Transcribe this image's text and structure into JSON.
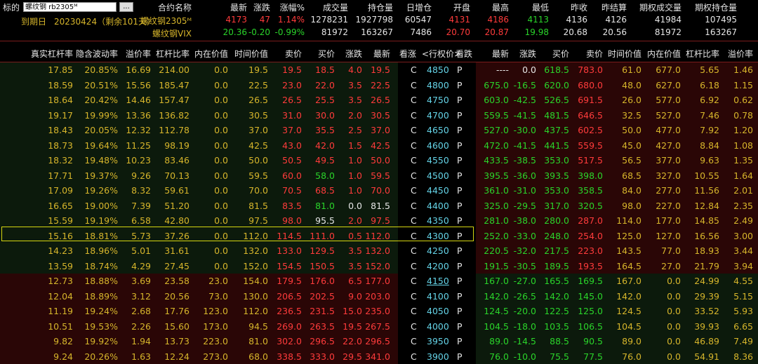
{
  "header": {
    "label_symbol": "标的",
    "symbol_input": "螺纹钢 rb2305ᴹ",
    "dots": "...",
    "expiry_label": "到期日",
    "expiry_value": "20230424（剩余101天）",
    "columns": [
      "合约名称",
      "最新",
      "涨跌",
      "涨幅%",
      "成交量",
      "持仓量",
      "日增仓",
      "开盘",
      "最高",
      "最低",
      "昨收",
      "昨结算",
      "期权成交量",
      "期权持仓量"
    ],
    "rows": [
      {
        "name": "螺纹钢2305ᴹ",
        "latest": "4173",
        "change": "47",
        "pct": "1.14%",
        "volume": "1278231",
        "oi": "1927798",
        "daily_oi": "60547",
        "open": "4131",
        "high": "4186",
        "low": "4113",
        "prev_close": "4136",
        "prev_settle": "4126",
        "opt_vol": "41984",
        "opt_oi": "107495"
      },
      {
        "name": "螺纹钢VIX",
        "latest": "20.36",
        "change": "-0.20",
        "pct": "-0.99%",
        "volume": "81972",
        "oi": "163267",
        "daily_oi": "7486",
        "open": "20.70",
        "high": "20.87",
        "low": "19.98",
        "prev_close": "20.68",
        "prev_settle": "20.56",
        "opt_vol": "81972",
        "opt_oi": "163267"
      }
    ]
  },
  "table": {
    "call_headers": [
      "真实杠杆率",
      "隐含波动率",
      "溢价率",
      "杠杆比率",
      "内在价值",
      "时间价值",
      "卖价",
      "买价",
      "涨跌",
      "最新"
    ],
    "mid_headers": [
      "看涨",
      "<行权价>",
      "看跌"
    ],
    "put_headers": [
      "最新",
      "涨跌",
      "买价",
      "卖价",
      "时间价值",
      "内在价值",
      "杠杆比率",
      "溢价率"
    ],
    "rows": [
      {
        "c": [
          "17.85",
          "20.85%",
          "16.69",
          "214.00",
          "0.0",
          "19.5",
          "19.5",
          "18.5",
          "4.0",
          "19.5"
        ],
        "strike": "4850",
        "p": [
          "----",
          "0.0",
          "618.5",
          "783.0",
          "61.0",
          "677.0",
          "5.65",
          "1.46"
        ]
      },
      {
        "c": [
          "18.59",
          "20.51%",
          "15.56",
          "185.47",
          "0.0",
          "22.5",
          "23.0",
          "22.0",
          "3.5",
          "22.5"
        ],
        "strike": "4800",
        "p": [
          "675.0",
          "-16.5",
          "620.0",
          "680.0",
          "48.0",
          "627.0",
          "6.18",
          "1.15"
        ]
      },
      {
        "c": [
          "18.64",
          "20.42%",
          "14.46",
          "157.47",
          "0.0",
          "26.5",
          "26.5",
          "25.5",
          "3.5",
          "26.5"
        ],
        "strike": "4750",
        "p": [
          "603.0",
          "-42.5",
          "526.5",
          "691.5",
          "26.0",
          "577.0",
          "6.92",
          "0.62"
        ]
      },
      {
        "c": [
          "19.17",
          "19.99%",
          "13.36",
          "136.82",
          "0.0",
          "30.5",
          "31.0",
          "30.0",
          "2.0",
          "30.5"
        ],
        "strike": "4700",
        "p": [
          "559.5",
          "-41.5",
          "481.5",
          "646.5",
          "32.5",
          "527.0",
          "7.46",
          "0.78"
        ]
      },
      {
        "c": [
          "18.43",
          "20.05%",
          "12.32",
          "112.78",
          "0.0",
          "37.0",
          "37.0",
          "35.5",
          "2.5",
          "37.0"
        ],
        "strike": "4650",
        "p": [
          "527.0",
          "-30.0",
          "437.5",
          "602.5",
          "50.0",
          "477.0",
          "7.92",
          "1.20"
        ]
      },
      {
        "c": [
          "18.73",
          "19.64%",
          "11.25",
          "98.19",
          "0.0",
          "42.5",
          "43.0",
          "42.0",
          "1.5",
          "42.5"
        ],
        "strike": "4600",
        "p": [
          "472.0",
          "-41.5",
          "441.5",
          "559.5",
          "45.0",
          "427.0",
          "8.84",
          "1.08"
        ]
      },
      {
        "c": [
          "18.32",
          "19.48%",
          "10.23",
          "83.46",
          "0.0",
          "50.0",
          "50.5",
          "49.5",
          "1.0",
          "50.0"
        ],
        "strike": "4550",
        "p": [
          "433.5",
          "-38.5",
          "353.0",
          "517.5",
          "56.5",
          "377.0",
          "9.63",
          "1.35"
        ]
      },
      {
        "c": [
          "17.71",
          "19.37%",
          "9.26",
          "70.13",
          "0.0",
          "59.5",
          "60.0",
          "58.0",
          "1.0",
          "59.5"
        ],
        "strike": "4500",
        "p": [
          "395.5",
          "-36.0",
          "393.5",
          "398.0",
          "68.5",
          "327.0",
          "10.55",
          "1.64"
        ]
      },
      {
        "c": [
          "17.09",
          "19.26%",
          "8.32",
          "59.61",
          "0.0",
          "70.0",
          "70.5",
          "68.5",
          "1.0",
          "70.0"
        ],
        "strike": "4450",
        "p": [
          "361.0",
          "-31.0",
          "353.0",
          "358.5",
          "84.0",
          "277.0",
          "11.56",
          "2.01"
        ]
      },
      {
        "c": [
          "16.65",
          "19.00%",
          "7.39",
          "51.20",
          "0.0",
          "81.5",
          "83.5",
          "81.0",
          "0.0",
          "81.5"
        ],
        "strike": "4400",
        "p": [
          "325.0",
          "-29.5",
          "317.0",
          "320.5",
          "98.0",
          "227.0",
          "12.84",
          "2.35"
        ]
      },
      {
        "c": [
          "15.59",
          "19.19%",
          "6.58",
          "42.80",
          "0.0",
          "97.5",
          "98.0",
          "95.5",
          "2.0",
          "97.5"
        ],
        "strike": "4350",
        "p": [
          "281.0",
          "-38.0",
          "280.0",
          "287.0",
          "114.0",
          "177.0",
          "14.85",
          "2.49"
        ]
      },
      {
        "c": [
          "15.16",
          "18.81%",
          "5.73",
          "37.26",
          "0.0",
          "112.0",
          "114.5",
          "111.0",
          "0.5",
          "112.0"
        ],
        "strike": "4300",
        "p": [
          "252.0",
          "-33.0",
          "248.0",
          "254.0",
          "125.0",
          "127.0",
          "16.56",
          "3.00"
        ]
      },
      {
        "c": [
          "14.23",
          "18.96%",
          "5.01",
          "31.61",
          "0.0",
          "132.0",
          "133.0",
          "129.5",
          "3.5",
          "132.0"
        ],
        "strike": "4250",
        "p": [
          "220.5",
          "-32.0",
          "217.5",
          "223.0",
          "143.5",
          "77.0",
          "18.93",
          "3.44"
        ]
      },
      {
        "c": [
          "13.59",
          "18.74%",
          "4.29",
          "27.45",
          "0.0",
          "152.0",
          "154.5",
          "150.5",
          "3.5",
          "152.0"
        ],
        "strike": "4200",
        "p": [
          "191.5",
          "-30.5",
          "189.5",
          "193.5",
          "164.5",
          "27.0",
          "21.79",
          "3.94"
        ]
      },
      {
        "c": [
          "12.73",
          "18.88%",
          "3.69",
          "23.58",
          "23.0",
          "154.0",
          "179.5",
          "176.0",
          "6.5",
          "177.0"
        ],
        "strike": "4150",
        "p": [
          "167.0",
          "-27.0",
          "165.5",
          "169.5",
          "167.0",
          "0.0",
          "24.99",
          "4.55"
        ]
      },
      {
        "c": [
          "12.04",
          "18.89%",
          "3.12",
          "20.56",
          "73.0",
          "130.0",
          "206.5",
          "202.5",
          "9.0",
          "203.0"
        ],
        "strike": "4100",
        "p": [
          "142.0",
          "-26.5",
          "142.0",
          "145.0",
          "142.0",
          "0.0",
          "29.39",
          "5.15"
        ]
      },
      {
        "c": [
          "11.19",
          "19.24%",
          "2.68",
          "17.76",
          "123.0",
          "112.0",
          "236.5",
          "231.5",
          "15.0",
          "235.0"
        ],
        "strike": "4050",
        "p": [
          "124.5",
          "-20.0",
          "122.5",
          "125.0",
          "124.5",
          "0.0",
          "33.52",
          "5.93"
        ]
      },
      {
        "c": [
          "10.51",
          "19.53%",
          "2.26",
          "15.60",
          "173.0",
          "94.5",
          "269.0",
          "263.5",
          "19.5",
          "267.5"
        ],
        "strike": "4000",
        "p": [
          "104.5",
          "-18.0",
          "103.5",
          "106.5",
          "104.5",
          "0.0",
          "39.93",
          "6.65"
        ]
      },
      {
        "c": [
          "9.82",
          "19.92%",
          "1.94",
          "13.73",
          "223.0",
          "81.0",
          "302.0",
          "296.5",
          "22.0",
          "296.5"
        ],
        "strike": "3950",
        "p": [
          "89.0",
          "-14.5",
          "88.5",
          "90.5",
          "89.0",
          "0.0",
          "46.89",
          "7.49"
        ]
      },
      {
        "c": [
          "9.24",
          "20.26%",
          "1.63",
          "12.24",
          "273.0",
          "68.0",
          "338.5",
          "333.0",
          "29.5",
          "341.0"
        ],
        "strike": "3900",
        "p": [
          "76.0",
          "-10.0",
          "75.5",
          "77.5",
          "76.0",
          "0.0",
          "54.91",
          "8.36"
        ]
      }
    ]
  },
  "colors": {
    "gold": "#d6b52b",
    "red": "#ff3b3b",
    "green": "#2ad42a",
    "cyan": "#64d2e6"
  }
}
